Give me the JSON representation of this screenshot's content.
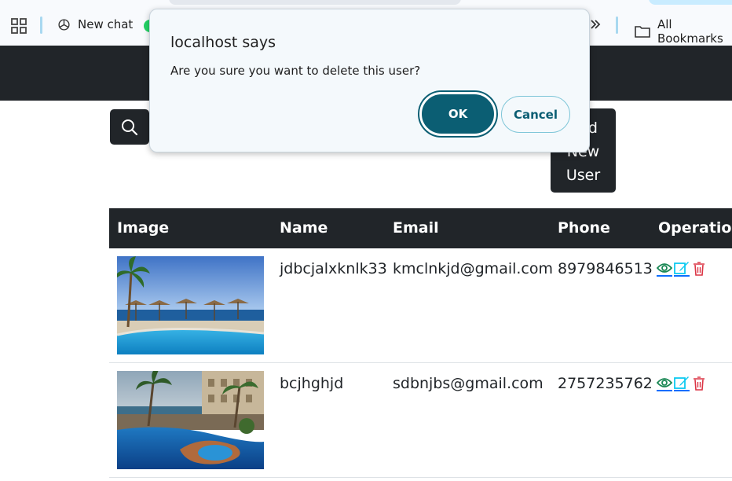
{
  "bookmarks": {
    "items": [
      {
        "label": "New chat",
        "icon": "openai-icon"
      },
      {
        "label": "All Bookmarks",
        "icon": "folder-icon"
      }
    ],
    "apps_icon": "apps-grid-icon",
    "overflow_icon": "double-chevron-right-icon"
  },
  "toolbar": {
    "add_user_label": "Add New User",
    "search_icon": "search-icon"
  },
  "table": {
    "headers": [
      "Image",
      "Name",
      "Email",
      "Phone",
      "Operations"
    ],
    "rows": [
      {
        "name": "jdbcjalxknlk33",
        "email": "kmclnkjd@gmail.com",
        "phone": "8979846513"
      },
      {
        "name": "bcjhghjd",
        "email": "sdbnjbs@gmail.com",
        "phone": "2757235762"
      }
    ],
    "operation_icons": [
      "eye-icon",
      "edit-icon",
      "trash-icon"
    ]
  },
  "dialog": {
    "title": "localhost says",
    "message": "Are you sure you want to delete this user?",
    "ok_label": "OK",
    "cancel_label": "Cancel"
  },
  "colors": {
    "navbar": "#212529",
    "dialog_accent": "#0b5e73",
    "view_icon": "#198754",
    "edit_icon": "#0dcaf0",
    "delete_icon": "#dc3545"
  }
}
